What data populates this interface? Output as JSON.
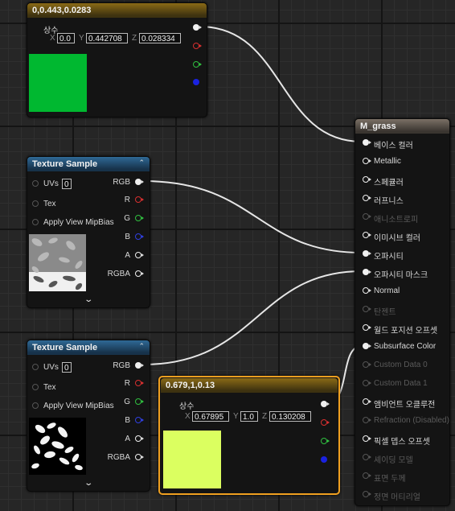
{
  "nodes": {
    "const_top": {
      "title": "0,0.443,0.0283",
      "label": "상수",
      "axes": {
        "x": "X",
        "y": "Y",
        "z": "Z"
      },
      "x": "0.0",
      "y": "0.442708",
      "z": "0.028334",
      "swatch_color": "#00b830"
    },
    "tex1": {
      "title": "Texture Sample",
      "uvs_label": "UVs",
      "uvs_value": "0",
      "tex_label": "Tex",
      "mip_label": "Apply View MipBias",
      "outputs": {
        "rgb": "RGB",
        "r": "R",
        "g": "G",
        "b": "B",
        "a": "A",
        "rgba": "RGBA"
      }
    },
    "tex2": {
      "title": "Texture Sample",
      "uvs_label": "UVs",
      "uvs_value": "0",
      "tex_label": "Tex",
      "mip_label": "Apply View MipBias",
      "outputs": {
        "rgb": "RGB",
        "r": "R",
        "g": "G",
        "b": "B",
        "a": "A",
        "rgba": "RGBA"
      }
    },
    "const_bottom": {
      "title": "0.679,1,0.13",
      "label": "상수",
      "axes": {
        "x": "X",
        "y": "Y",
        "z": "Z"
      },
      "x": "0.67895",
      "y": "1.0",
      "z": "0.130208",
      "swatch_color": "#dbff60"
    },
    "material": {
      "title": "M_grass",
      "inputs": [
        {
          "label": "베이스 컬러",
          "state": "connected"
        },
        {
          "label": "Metallic",
          "state": "open"
        },
        {
          "label": "스페큘러",
          "state": "open"
        },
        {
          "label": "러프니스",
          "state": "open"
        },
        {
          "label": "애니소트로피",
          "state": "disabled"
        },
        {
          "label": "이미시브 컬러",
          "state": "open"
        },
        {
          "label": "오파시티",
          "state": "connected"
        },
        {
          "label": "오파시티 마스크",
          "state": "connected"
        },
        {
          "label": "Normal",
          "state": "open"
        },
        {
          "label": "탄젠트",
          "state": "disabled"
        },
        {
          "label": "월드 포지션 오프셋",
          "state": "open"
        },
        {
          "label": "Subsurface Color",
          "state": "connected"
        },
        {
          "label": "Custom Data 0",
          "state": "disabled"
        },
        {
          "label": "Custom Data 1",
          "state": "disabled"
        },
        {
          "label": "앰비언트 오클루전",
          "state": "open"
        },
        {
          "label": "Refraction (Disabled)",
          "state": "disabled"
        },
        {
          "label": "픽셀 뎁스 오프셋",
          "state": "open"
        },
        {
          "label": "셰이딩 모델",
          "state": "disabled"
        },
        {
          "label": "표면 두께",
          "state": "disabled"
        },
        {
          "label": "정면 머티리얼",
          "state": "disabled"
        }
      ]
    }
  }
}
